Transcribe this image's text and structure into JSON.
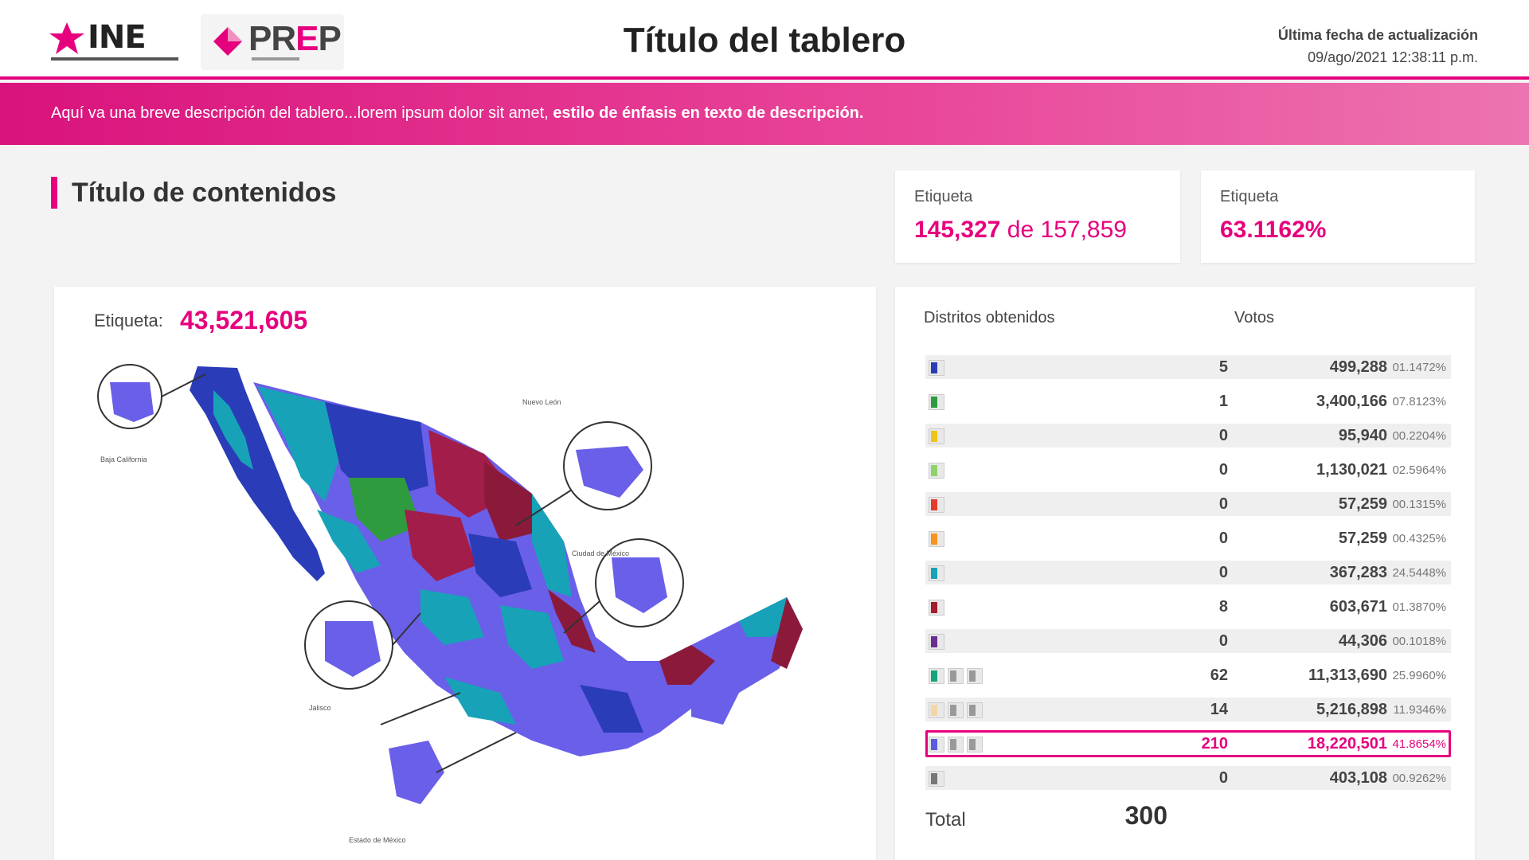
{
  "header": {
    "ine_logo_text": "INE",
    "prep_logo_text_a": "PR",
    "prep_logo_text_b": "E",
    "prep_logo_text_c": "P",
    "title": "Título del tablero",
    "update_label": "Última fecha de actualización",
    "update_value": "09/ago/2021 12:38:11 p.m."
  },
  "description": {
    "text": "Aquí va una breve descripción del tablero...lorem ipsum dolor sit amet, ",
    "emphasis": "estilo de énfasis en texto de descripción."
  },
  "section": {
    "title": "Título de contenidos"
  },
  "kpis": [
    {
      "label": "Etiqueta",
      "value_a": "145,327",
      "connector": "de",
      "value_b": "157,859"
    },
    {
      "label": "Etiqueta",
      "value": "63.1162%"
    }
  ],
  "map": {
    "label": "Etiqueta:",
    "value": "43,521,605",
    "annotations": [
      "Baja California",
      "Nuevo León",
      "Ciudad de México",
      "Jalisco",
      "Estado de México"
    ]
  },
  "table": {
    "col_districts": "Distritos obtenidos",
    "col_votes": "Votos",
    "rows": [
      {
        "colors": [
          "#2b3cb8"
        ],
        "districts": "5",
        "votes": "499,288",
        "pct": "01.1472%"
      },
      {
        "colors": [
          "#2e9c3e"
        ],
        "districts": "1",
        "votes": "3,400,166",
        "pct": "07.8123%"
      },
      {
        "colors": [
          "#f0c419"
        ],
        "districts": "0",
        "votes": "95,940",
        "pct": "00.2204%"
      },
      {
        "colors": [
          "#8ed36a"
        ],
        "districts": "0",
        "votes": "1,130,021",
        "pct": "02.5964%"
      },
      {
        "colors": [
          "#e53b2c"
        ],
        "districts": "0",
        "votes": "57,259",
        "pct": "00.1315%"
      },
      {
        "colors": [
          "#f7931e"
        ],
        "districts": "0",
        "votes": "57,259",
        "pct": "00.4325%"
      },
      {
        "colors": [
          "#17a2b8"
        ],
        "districts": "0",
        "votes": "367,283",
        "pct": "24.5448%"
      },
      {
        "colors": [
          "#a31d2d"
        ],
        "districts": "8",
        "votes": "603,671",
        "pct": "01.3870%"
      },
      {
        "colors": [
          "#6a2d91"
        ],
        "districts": "0",
        "votes": "44,306",
        "pct": "00.1018%"
      },
      {
        "colors": [
          "#15a37a",
          "#999",
          "#999"
        ],
        "districts": "62",
        "votes": "11,313,690",
        "pct": "25.9960%"
      },
      {
        "colors": [
          "#f1d7a8",
          "#999",
          "#999"
        ],
        "districts": "14",
        "votes": "5,216,898",
        "pct": "11.9346%"
      },
      {
        "colors": [
          "#5b5be0",
          "#999",
          "#999"
        ],
        "districts": "210",
        "votes": "18,220,501",
        "pct": "41.8654%",
        "highlight": true
      },
      {
        "colors": [
          "#777"
        ],
        "districts": "0",
        "votes": "403,108",
        "pct": "00.9262%"
      }
    ],
    "total_label": "Total",
    "total_value": "300"
  },
  "colors": {
    "accent": "#e6007e",
    "map_party_a": "#6a5fe8",
    "map_party_b": "#17a2b8",
    "map_party_c": "#a31d4a",
    "map_party_d": "#2b3cb8",
    "map_party_e": "#2e9c3e"
  }
}
